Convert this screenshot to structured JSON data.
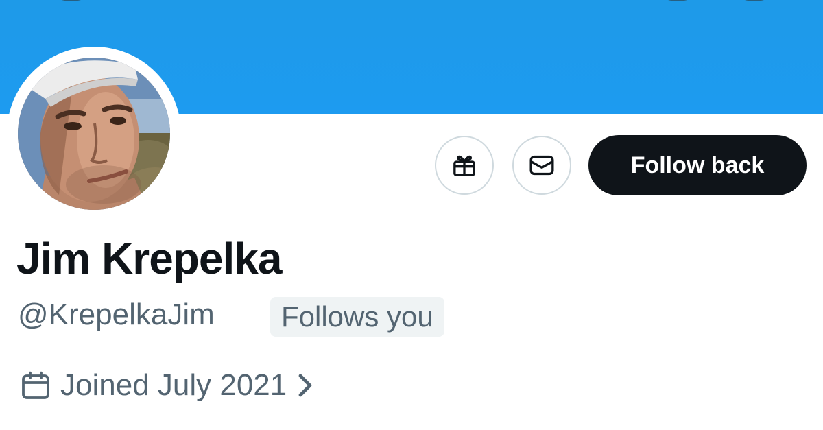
{
  "profile": {
    "display_name": "Jim Krepelka",
    "handle": "@KrepelkaJim",
    "follows_you_badge": "Follows you",
    "joined": "Joined July 2021"
  },
  "actions": {
    "gift_icon": "gift-icon",
    "message_icon": "envelope-icon",
    "follow_label": "Follow back"
  },
  "icons": {
    "calendar": "calendar-icon",
    "chevron": "chevron-right-icon"
  },
  "colors": {
    "banner": "#1d9bf0",
    "primary_text": "#0f1419",
    "secondary_text": "#536471",
    "badge_bg": "#eff3f4",
    "button_border": "#cfd9de"
  }
}
